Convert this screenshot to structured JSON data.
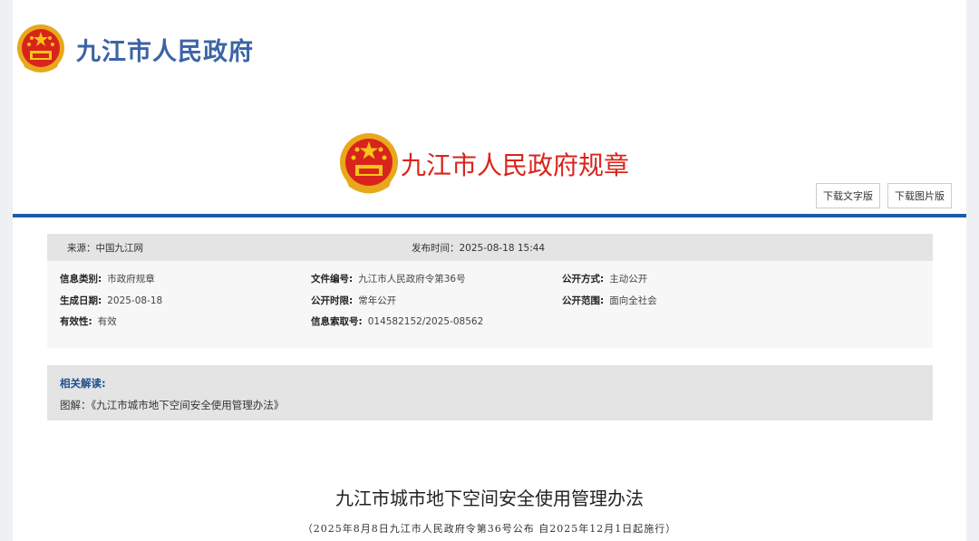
{
  "site": {
    "title": "九江市人民政府"
  },
  "banner": {
    "title": "九江市人民政府规章"
  },
  "download": {
    "text_version": "下载文字版",
    "image_version": "下载图片版"
  },
  "meta": {
    "source": "来源：中国九江网",
    "publish_time": "发布时间：2025-08-18 15:44",
    "rows": [
      [
        {
          "label": "信息类别:",
          "value": "市政府规章"
        },
        {
          "label": "文件编号:",
          "value": "九江市人民政府令第36号"
        },
        {
          "label": "公开方式:",
          "value": "主动公开"
        }
      ],
      [
        {
          "label": "生成日期:",
          "value": "2025-08-18"
        },
        {
          "label": "公开时限:",
          "value": "常年公开"
        },
        {
          "label": "公开范围:",
          "value": "面向全社会"
        }
      ],
      [
        {
          "label": "有效性:",
          "value": "有效"
        },
        {
          "label": "信息索取号:",
          "value": "014582152/2025-08562"
        }
      ]
    ]
  },
  "related": {
    "title": "相关解读:",
    "prefix": "图解：",
    "link": "《九江市城市地下空间安全使用管理办法》"
  },
  "document": {
    "title": "九江市城市地下空间安全使用管理办法",
    "subtitle": "（2025年8月8日九江市人民政府令第36号公布 自2025年12月1日起施行）"
  },
  "colors": {
    "blue": "#3b64a6",
    "red": "#d9241c",
    "rule": "#1a5ca8"
  }
}
